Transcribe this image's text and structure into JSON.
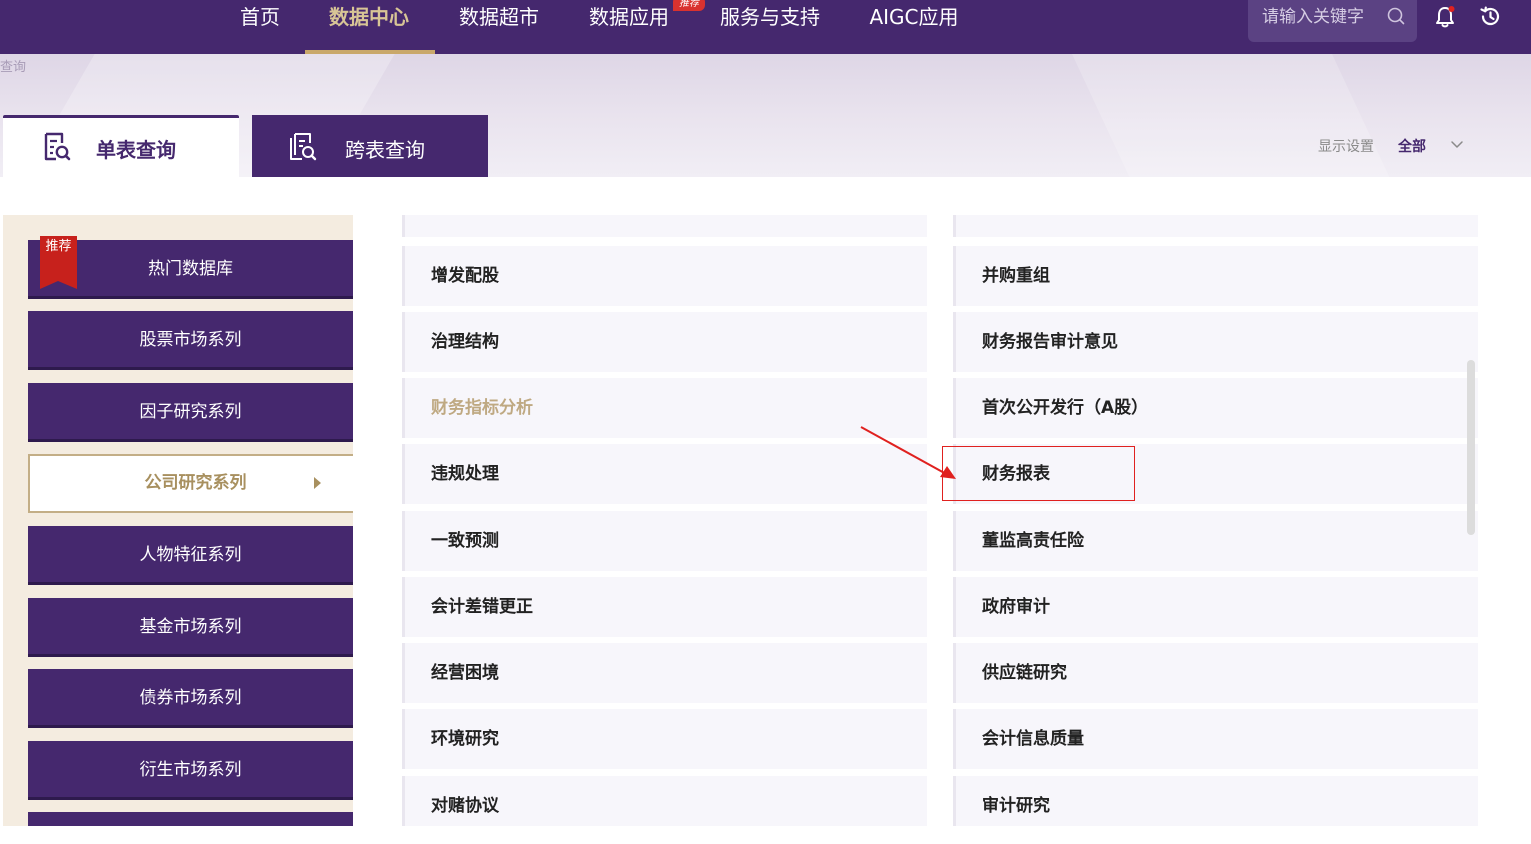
{
  "nav": {
    "items": [
      {
        "label": "首页"
      },
      {
        "label": "数据中心"
      },
      {
        "label": "数据超市"
      },
      {
        "label": "数据应用"
      },
      {
        "label": "服务与支持"
      },
      {
        "label": "AIGC应用"
      }
    ],
    "badge": "推荐",
    "search_placeholder": "请输入关键字"
  },
  "breadcrumb": "查询",
  "tabs": {
    "single": "单表查询",
    "cross": "跨表查询"
  },
  "display": {
    "label": "显示设置",
    "value": "全部"
  },
  "sidebar": {
    "badge": "推荐",
    "items": [
      {
        "label": "热门数据库"
      },
      {
        "label": "股票市场系列"
      },
      {
        "label": "因子研究系列"
      },
      {
        "label": "公司研究系列"
      },
      {
        "label": "人物特征系列"
      },
      {
        "label": "基金市场系列"
      },
      {
        "label": "债券市场系列"
      },
      {
        "label": "衍生市场系列"
      }
    ]
  },
  "grid": {
    "left": [
      {
        "label": "增发配股"
      },
      {
        "label": "治理结构"
      },
      {
        "label": "财务指标分析"
      },
      {
        "label": "违规处理"
      },
      {
        "label": "一致预测"
      },
      {
        "label": "会计差错更正"
      },
      {
        "label": "经营困境"
      },
      {
        "label": "环境研究"
      },
      {
        "label": "对赌协议"
      }
    ],
    "right": [
      {
        "label": "并购重组"
      },
      {
        "label": "财务报告审计意见"
      },
      {
        "label": "首次公开发行（A股）"
      },
      {
        "label": "财务报表"
      },
      {
        "label": "董监高责任险"
      },
      {
        "label": "政府审计"
      },
      {
        "label": "供应链研究"
      },
      {
        "label": "会计信息质量"
      },
      {
        "label": "审计研究"
      }
    ]
  },
  "colors": {
    "brand": "#45286e",
    "accent": "#c9a86b",
    "highlight": "#e0211f"
  }
}
